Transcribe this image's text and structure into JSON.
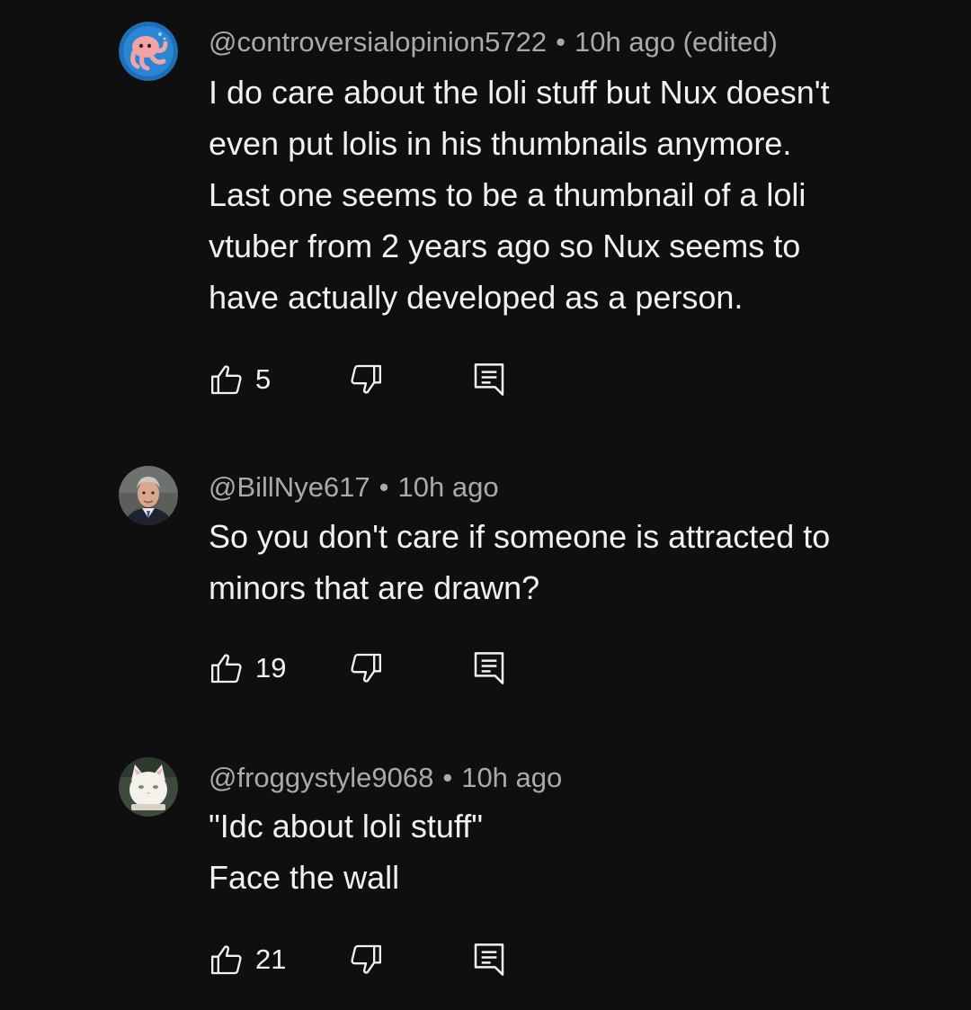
{
  "comments": [
    {
      "handle": "@controversialopinion5722",
      "separator": "•",
      "time": "10h ago (edited)",
      "lines": [
        "I do care about the loli stuff but Nux doesn't",
        "even put lolis in his thumbnails anymore.",
        "Last one seems to be a thumbnail of a loli",
        "vtuber from 2 years ago so Nux seems to",
        "have actually developed as a person."
      ],
      "likes": "5",
      "avatar_icon": "octopus-avatar"
    },
    {
      "handle": "@BillNye617",
      "separator": "•",
      "time": "10h ago",
      "lines": [
        "So you don't care if someone is attracted to",
        "minors that are drawn?"
      ],
      "likes": "19",
      "avatar_icon": "man-portrait-avatar"
    },
    {
      "handle": "@froggystyle9068",
      "separator": "•",
      "time": "10h ago",
      "lines": [
        "\"Idc about loli stuff\"",
        "Face the wall"
      ],
      "likes": "21",
      "avatar_icon": "white-cat-avatar"
    }
  ],
  "icons": {
    "like": "thumbs-up-icon",
    "dislike": "thumbs-down-icon",
    "reply": "reply-comment-icon"
  },
  "colors": {
    "background": "#0f0f0f",
    "text_primary": "#f1f1f1",
    "text_secondary": "#aaaaaa"
  }
}
